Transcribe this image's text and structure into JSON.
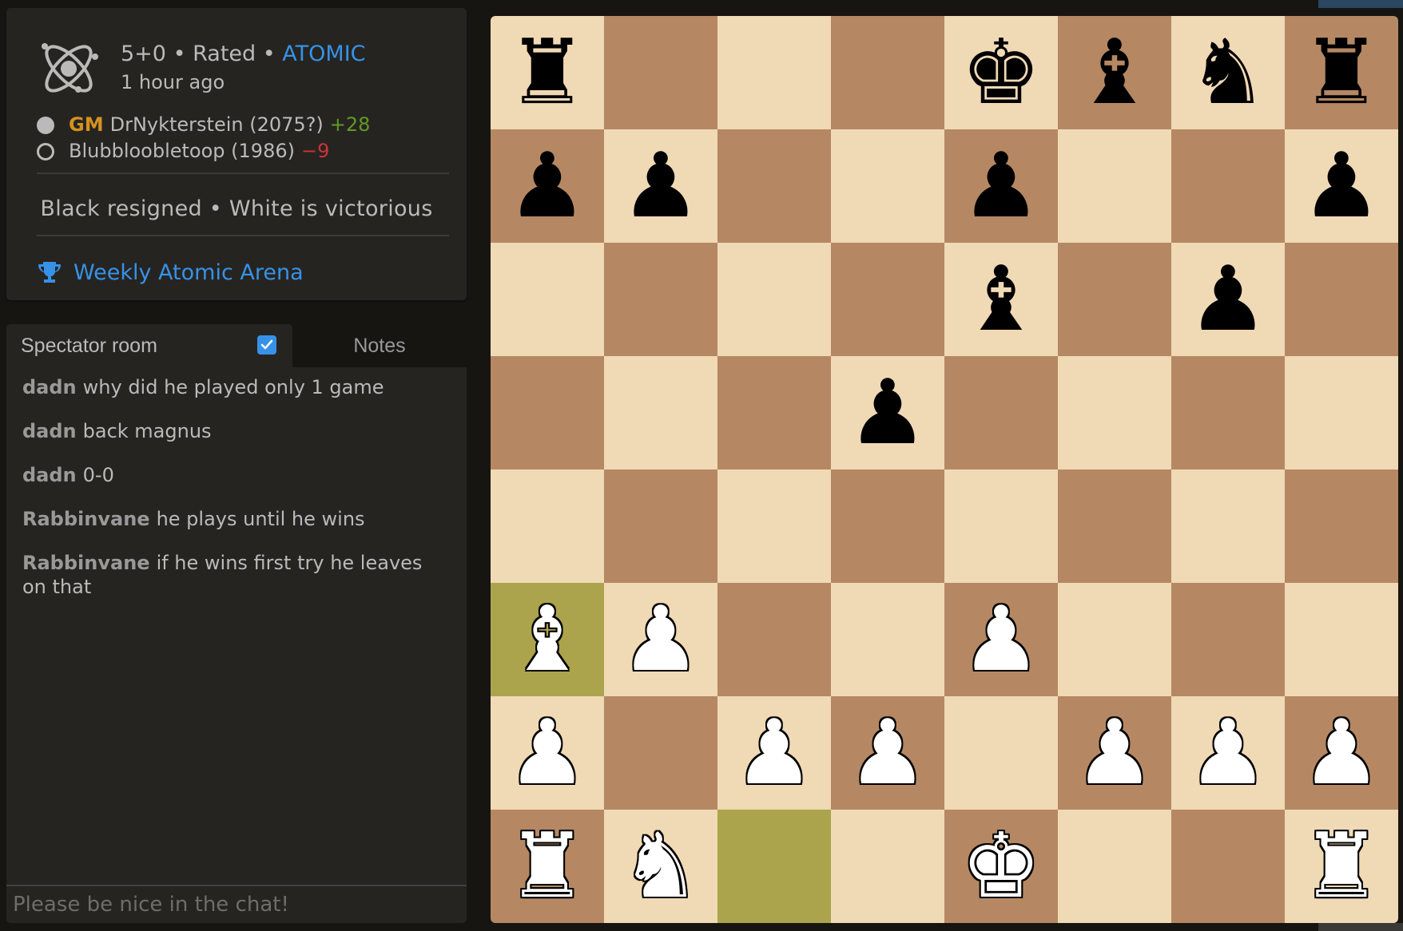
{
  "game": {
    "clock": "5+0",
    "rated": "Rated",
    "variant": "ATOMIC",
    "separator": "•",
    "time_ago": "1 hour ago",
    "players": [
      {
        "color": "white",
        "title": "GM",
        "name": "DrNykterstein",
        "rating": "(2075?)",
        "diff": "+28"
      },
      {
        "color": "black",
        "title": "",
        "name": "Blubbloobletoop",
        "rating": "(1986)",
        "diff": "−9"
      }
    ],
    "status": "Black resigned • White is victorious",
    "tournament": "Weekly Atomic Arena"
  },
  "chat": {
    "tabs": [
      {
        "label": "Spectator room",
        "active": true,
        "checkbox_checked": true
      },
      {
        "label": "Notes",
        "active": false
      }
    ],
    "messages": [
      {
        "user": "dadn",
        "text": "why did he played only 1 game"
      },
      {
        "user": "dadn",
        "text": "back magnus"
      },
      {
        "user": "dadn",
        "text": "0-0"
      },
      {
        "user": "Rabbinvane",
        "text": "he plays until he wins"
      },
      {
        "user": "Rabbinvane",
        "text": "if he wins first try he leaves on that"
      }
    ],
    "input_placeholder": "Please be nice in the chat!"
  },
  "board": {
    "orientation": "white",
    "ranks": [
      "r...kbnr",
      "pp..p..p",
      "....b.p.",
      "...p....",
      "........",
      "BP..P...",
      "P.PP.PPP",
      "RN..K..R"
    ],
    "highlighted_squares": [
      "a3",
      "c1"
    ],
    "colors": {
      "light": "#f0d9b5",
      "dark": "#b58863",
      "highlight": "#aba44d"
    }
  },
  "colors": {
    "accent_blue": "#3692e7",
    "gm_title": "#d59120",
    "rating_gain": "#629924",
    "rating_loss": "#cc3333"
  }
}
